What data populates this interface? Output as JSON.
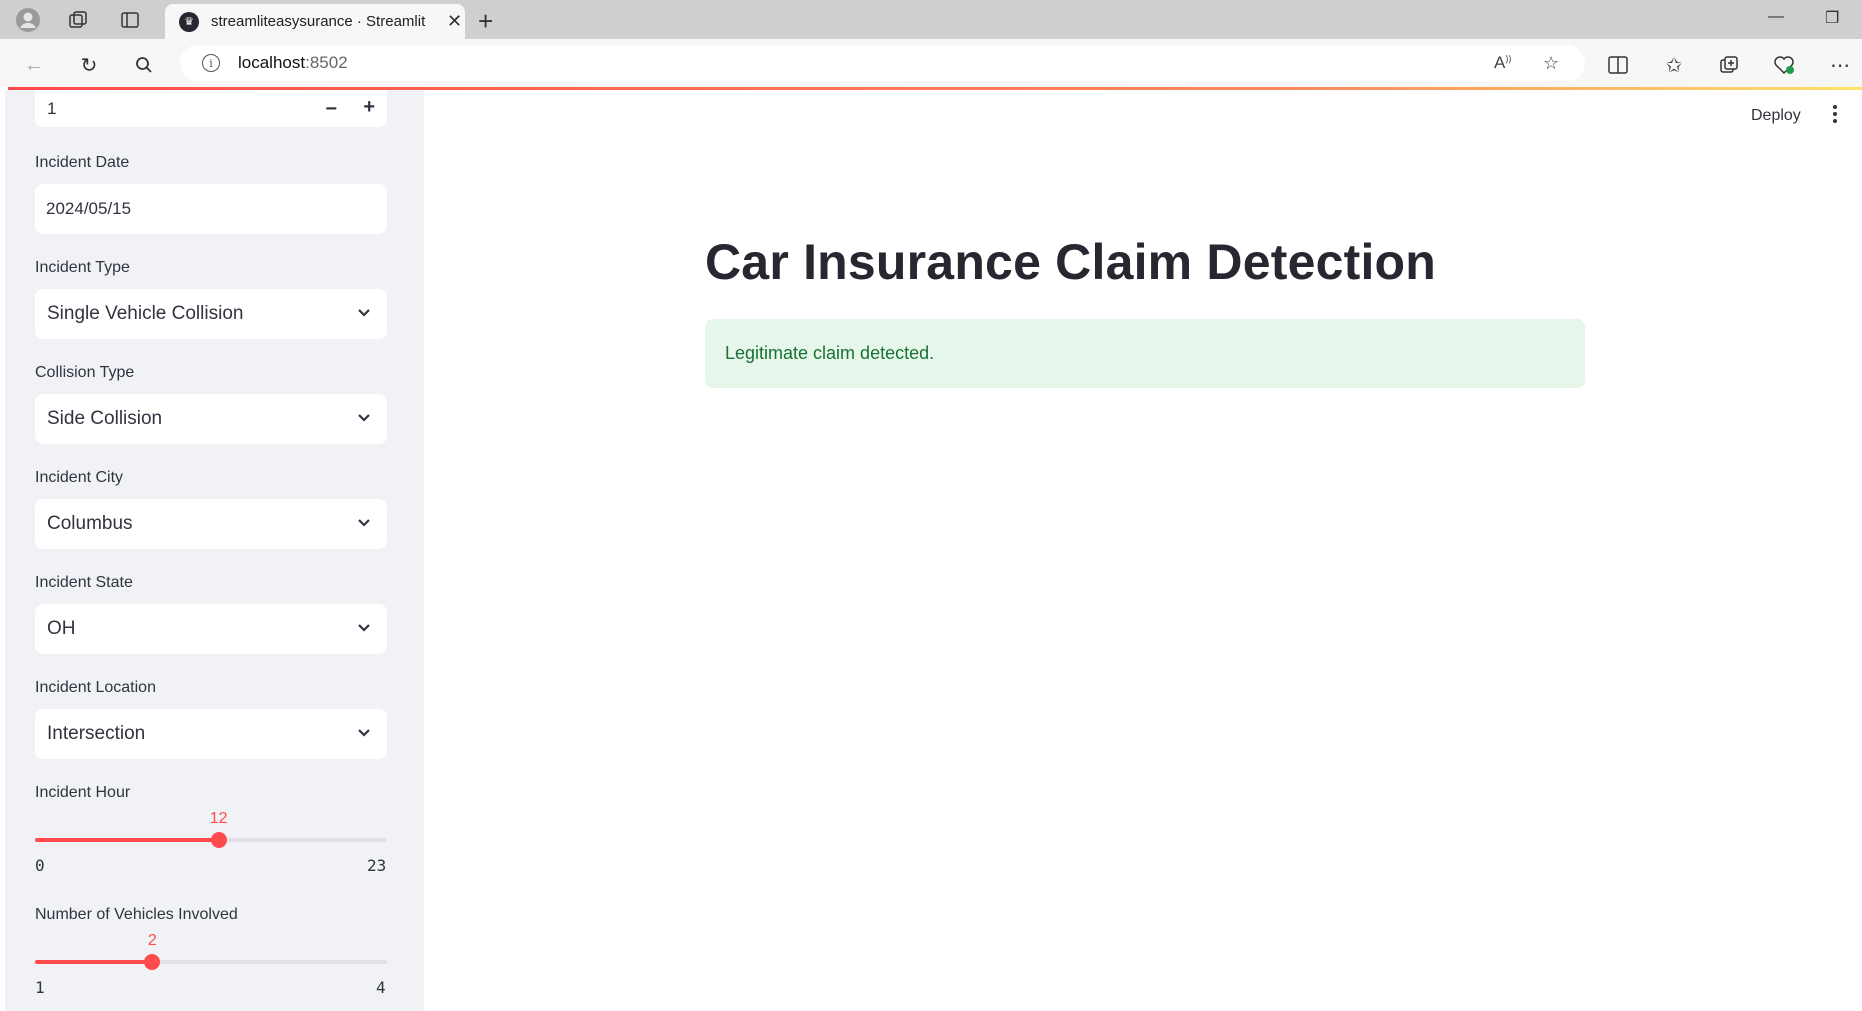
{
  "browser": {
    "tab_title": "streamliteasysurance · Streamlit",
    "url_host": "localhost",
    "url_port": ":8502"
  },
  "sidebar": {
    "number_input_value": "1",
    "incident_date": {
      "label": "Incident Date",
      "value": "2024/05/15"
    },
    "incident_type": {
      "label": "Incident Type",
      "value": "Single Vehicle Collision"
    },
    "collision_type": {
      "label": "Collision Type",
      "value": "Side Collision"
    },
    "incident_city": {
      "label": "Incident City",
      "value": "Columbus"
    },
    "incident_state": {
      "label": "Incident State",
      "value": "OH"
    },
    "incident_location": {
      "label": "Incident Location",
      "value": "Intersection"
    },
    "incident_hour": {
      "label": "Incident Hour",
      "value": 12,
      "min": 0,
      "max": 23,
      "value_text": "12",
      "min_text": "0",
      "max_text": "23"
    },
    "vehicles": {
      "label": "Number of Vehicles Involved",
      "value": 2,
      "min": 1,
      "max": 4,
      "value_text": "2",
      "min_text": "1",
      "max_text": "4"
    }
  },
  "header": {
    "deploy_label": "Deploy"
  },
  "main": {
    "title": "Car Insurance Claim Detection",
    "result_message": "Legitimate claim detected."
  },
  "colors": {
    "accent": "#ff4b4b",
    "success_bg": "#e7f6ea",
    "success_text": "#177233",
    "sidebar_bg": "#f0f2f6"
  }
}
